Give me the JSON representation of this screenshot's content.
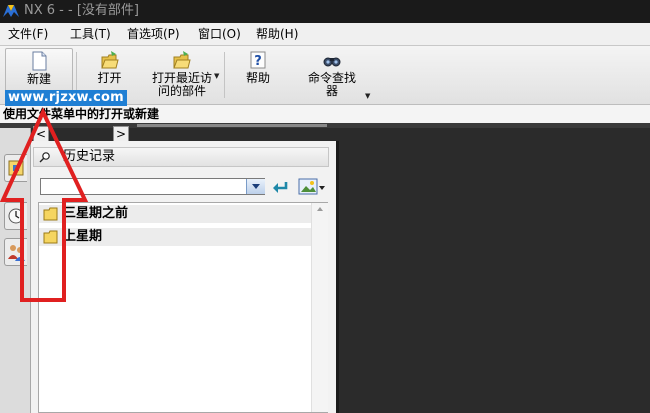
{
  "window": {
    "title": "NX 6 - - [没有部件]"
  },
  "menu": {
    "items": [
      {
        "label": "文件(F)"
      },
      {
        "label": "工具(T)"
      },
      {
        "label": "首选项(P)"
      },
      {
        "label": "窗口(O)"
      },
      {
        "label": "帮助(H)"
      }
    ]
  },
  "toolbar": {
    "new_label": "新建",
    "open_label": "打开",
    "open_recent_label_line1": "打开最近访",
    "open_recent_label_line2": "问的部件",
    "help_label": "帮助",
    "command_finder_label_line1": "命令查找",
    "command_finder_label_line2": "器"
  },
  "status": {
    "text": "使用文件菜单中的打开或新建"
  },
  "watermark": {
    "text": "www.rjzxw.com"
  },
  "nav": {
    "back_glyph": "<",
    "forward_glyph": ">"
  },
  "history_panel": {
    "title": "历史记录",
    "search": {
      "value": ""
    },
    "folders": [
      {
        "label": "三星期之前"
      },
      {
        "label": "上星期"
      }
    ]
  },
  "colors": {
    "annotation_red": "#e02020",
    "folder_yellow": "#f5d560",
    "titlebar_bg": "#1a1a1a",
    "graphics_bg": "#2b2b2b"
  }
}
